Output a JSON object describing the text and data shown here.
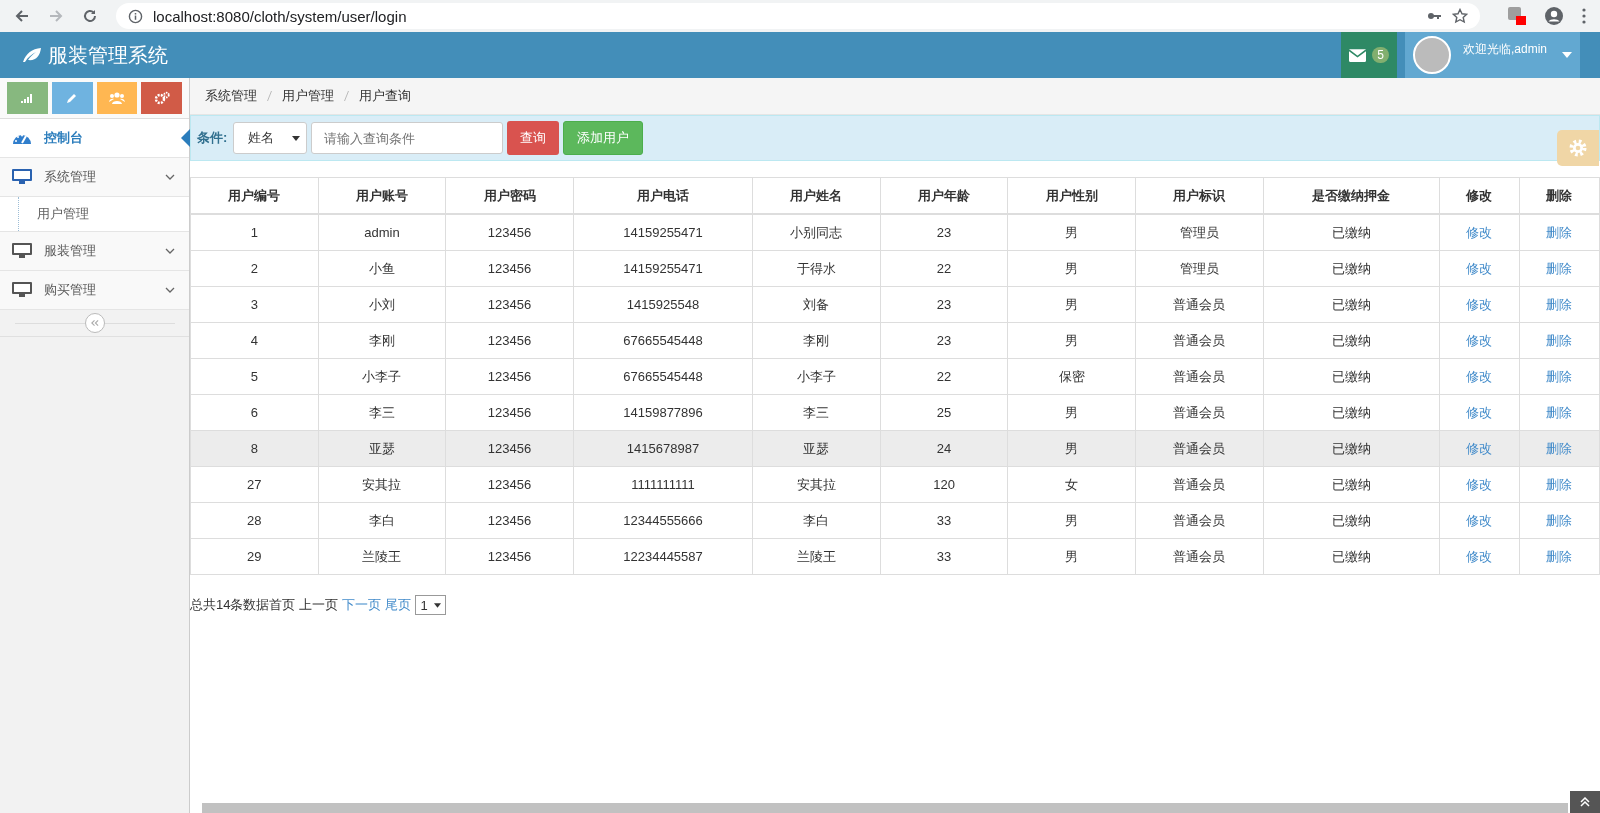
{
  "browser": {
    "url": "localhost:8080/cloth/system/user/login"
  },
  "header": {
    "title": "服装管理系统",
    "mail_count": "5",
    "welcome": "欢迎光临,admin"
  },
  "sidebar": {
    "shortcuts": [
      {
        "kind": "signal",
        "color": "#87b87f"
      },
      {
        "kind": "pencil",
        "color": "#6fb3e0"
      },
      {
        "kind": "users",
        "color": "#ffb752"
      },
      {
        "kind": "cogs",
        "color": "#d15b47"
      }
    ],
    "items": [
      {
        "label": "控制台",
        "kind": "dashboard",
        "selected": true,
        "expanded": false
      },
      {
        "label": "系统管理",
        "kind": "monitor",
        "selected": false,
        "expanded": true,
        "children": [
          {
            "label": "用户管理"
          }
        ]
      },
      {
        "label": "服装管理",
        "kind": "monitor",
        "selected": false,
        "expanded": false
      },
      {
        "label": "购买管理",
        "kind": "monitor",
        "selected": false,
        "expanded": false
      }
    ]
  },
  "breadcrumb": [
    "系统管理",
    "用户管理",
    "用户查询"
  ],
  "search": {
    "label": "条件:",
    "field": "姓名",
    "placeholder": "请输入查询条件",
    "query_button": "查询",
    "add_button": "添加用户"
  },
  "table": {
    "columns": [
      "用户编号",
      "用户账号",
      "用户密码",
      "用户电话",
      "用户姓名",
      "用户年龄",
      "用户性别",
      "用户标识",
      "是否缴纳押金",
      "修改",
      "删除"
    ],
    "rows": [
      {
        "highlighted": false,
        "cells": [
          "1",
          "admin",
          "123456",
          "14159255471",
          "小别同志",
          "23",
          "男",
          "管理员",
          "已缴纳"
        ],
        "edit": "修改",
        "delete": "删除"
      },
      {
        "highlighted": false,
        "cells": [
          "2",
          "小鱼",
          "123456",
          "14159255471",
          "于得水",
          "22",
          "男",
          "管理员",
          "已缴纳"
        ],
        "edit": "修改",
        "delete": "删除"
      },
      {
        "highlighted": false,
        "cells": [
          "3",
          "小刘",
          "123456",
          "1415925548",
          "刘备",
          "23",
          "男",
          "普通会员",
          "已缴纳"
        ],
        "edit": "修改",
        "delete": "删除"
      },
      {
        "highlighted": false,
        "cells": [
          "4",
          "李刚",
          "123456",
          "67665545448",
          "李刚",
          "23",
          "男",
          "普通会员",
          "已缴纳"
        ],
        "edit": "修改",
        "delete": "删除"
      },
      {
        "highlighted": false,
        "cells": [
          "5",
          "小李子",
          "123456",
          "67665545448",
          "小李子",
          "22",
          "保密",
          "普通会员",
          "已缴纳"
        ],
        "edit": "修改",
        "delete": "删除"
      },
      {
        "highlighted": false,
        "cells": [
          "6",
          "李三",
          "123456",
          "14159877896",
          "李三",
          "25",
          "男",
          "普通会员",
          "已缴纳"
        ],
        "edit": "修改",
        "delete": "删除"
      },
      {
        "highlighted": true,
        "cells": [
          "8",
          "亚瑟",
          "123456",
          "1415678987",
          "亚瑟",
          "24",
          "男",
          "普通会员",
          "已缴纳"
        ],
        "edit": "修改",
        "delete": "删除"
      },
      {
        "highlighted": false,
        "cells": [
          "27",
          "安其拉",
          "123456",
          "1111111111",
          "安其拉",
          "120",
          "女",
          "普通会员",
          "已缴纳"
        ],
        "edit": "修改",
        "delete": "删除"
      },
      {
        "highlighted": false,
        "cells": [
          "28",
          "李白",
          "123456",
          "12344555666",
          "李白",
          "33",
          "男",
          "普通会员",
          "已缴纳"
        ],
        "edit": "修改",
        "delete": "删除"
      },
      {
        "highlighted": false,
        "cells": [
          "29",
          "兰陵王",
          "123456",
          "12234445587",
          "兰陵王",
          "33",
          "男",
          "普通会员",
          "已缴纳"
        ],
        "edit": "修改",
        "delete": "删除"
      }
    ]
  },
  "pager": {
    "summary": "总共14条数据",
    "links": [
      {
        "label": "首页",
        "disabled": true
      },
      {
        "label": "上一页",
        "disabled": true
      },
      {
        "label": "下一页",
        "disabled": false
      },
      {
        "label": "尾页",
        "disabled": false
      }
    ],
    "page": "1"
  }
}
